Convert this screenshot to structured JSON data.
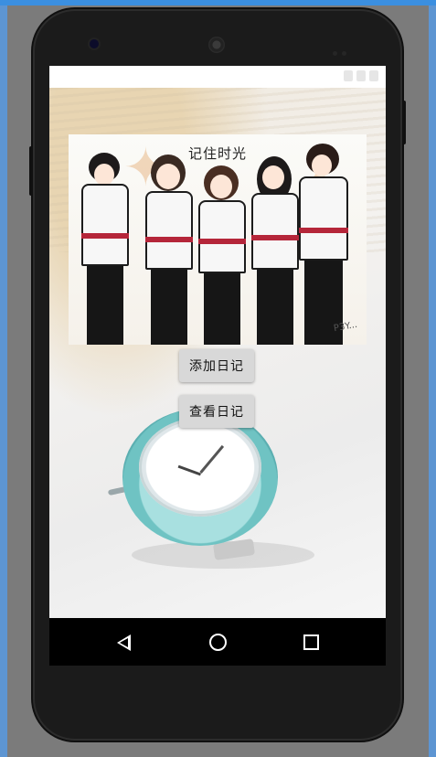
{
  "app": {
    "poster_title": "记住时光",
    "signature_text": "P3Y..."
  },
  "buttons": {
    "add_diary": "添加日记",
    "view_diary": "查看日记"
  },
  "navigation": {
    "back": "back",
    "home": "home",
    "recents": "recents"
  },
  "icons": {
    "back": "back-triangle-icon",
    "home": "home-circle-icon",
    "recents": "recents-square-icon"
  },
  "colors": {
    "button_bg": "#d8d8d8",
    "nav_bg": "#000000",
    "phone_body": "#1b1b1b",
    "accent_red": "#b5263a"
  }
}
